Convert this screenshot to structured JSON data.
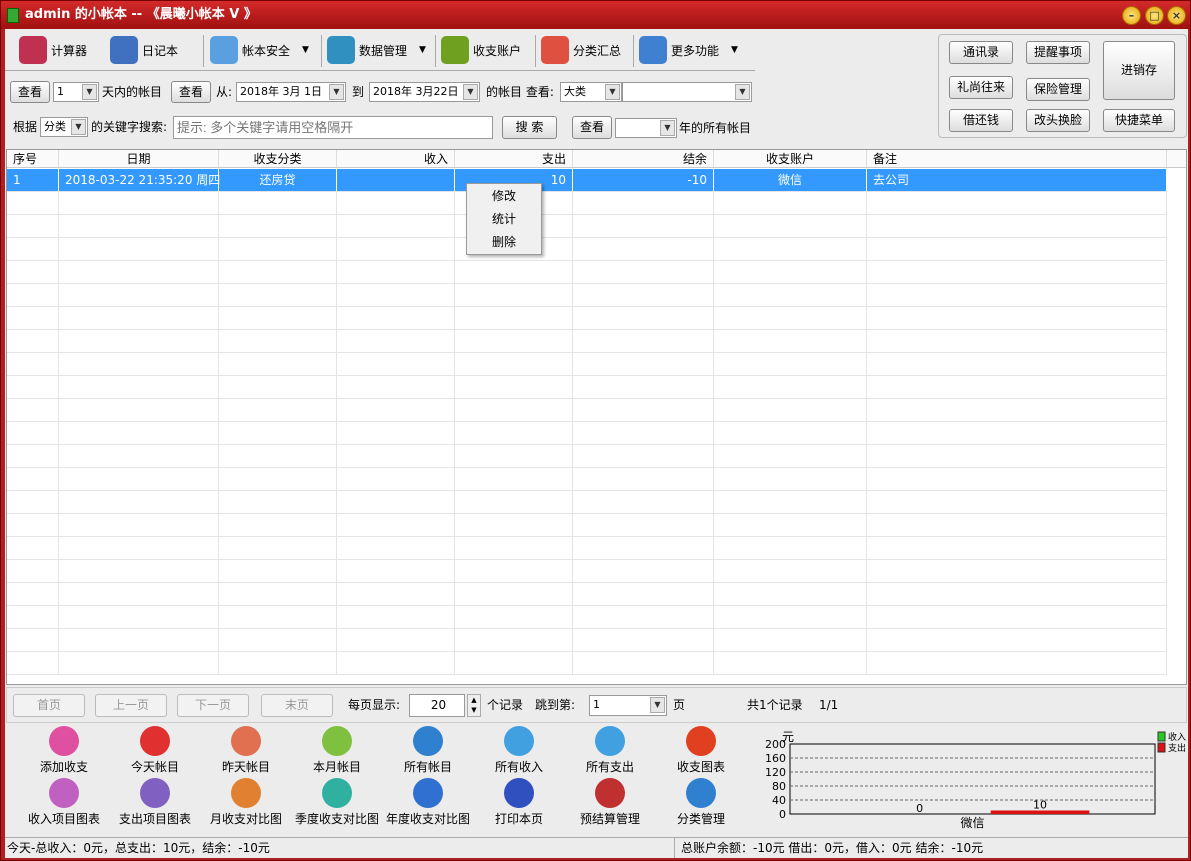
{
  "window": {
    "title": "admin 的小帐本 -- 《晨曦小帐本 V  》",
    "minimize": "–",
    "maximize": "□",
    "close": "×"
  },
  "toolbar": [
    {
      "label": "计算器",
      "icon": "calculator-icon",
      "color": "#c03050"
    },
    {
      "label": "日记本",
      "icon": "notebook-icon",
      "color": "#4070c0"
    },
    {
      "label": "帐本安全",
      "icon": "calendar-icon",
      "color": "#5aa0e0",
      "dropdown": true
    },
    {
      "label": "数据管理",
      "icon": "database-icon",
      "color": "#3090c0",
      "dropdown": true
    },
    {
      "label": "收支账户",
      "icon": "chart-icon",
      "color": "#70a020"
    },
    {
      "label": "分类汇总",
      "icon": "arrow-icon",
      "color": "#e05040"
    },
    {
      "label": "更多功能",
      "icon": "printer-icon",
      "color": "#4080d0",
      "dropdown": true
    }
  ],
  "quick": {
    "contacts": "通讯录",
    "reminders": "提醒事项",
    "inventory": "进销存",
    "gifts": "礼尚往来",
    "insurance": "保险管理",
    "loans": "借还钱",
    "skin": "改头换脸",
    "shortcut": "快捷菜单"
  },
  "filter": {
    "view": "查看",
    "days_value": "1",
    "days_label": "天内的帐目",
    "view2": "查看",
    "from_label": "从:",
    "from_date": "2018年 3月 1日",
    "to_label": "到",
    "to_date": "2018年 3月22日",
    "accounts_label": "的帐目 查看:",
    "category_level": "大类",
    "category_value": "",
    "by_label": "根据",
    "by_value": "分类",
    "keyword_label": "的关键字搜索:",
    "keyword_placeholder": "提示: 多个关键字请用空格隔开",
    "search": "搜 索",
    "view3": "查看",
    "year_value": "",
    "year_label": "年的所有帐目"
  },
  "table": {
    "columns": [
      "序号",
      "日期",
      "收支分类",
      "收入",
      "支出",
      "结余",
      "收支账户",
      "备注"
    ],
    "rows": [
      [
        "1",
        "2018-03-22 21:35:20 周四",
        "还房贷",
        "",
        "10",
        "-10",
        "微信",
        "去公司"
      ]
    ]
  },
  "context_menu": [
    "修改",
    "统计",
    "删除"
  ],
  "pagination": {
    "first": "首页",
    "prev": "上一页",
    "next": "下一页",
    "last": "末页",
    "per_page_label": "每页显示:",
    "per_page": "20",
    "records_label": "个记录",
    "jump_label": "跳到第:",
    "page": "1",
    "page_label": "页",
    "total": "共1个记录",
    "page_of": "1/1"
  },
  "shortcuts": [
    {
      "label": "添加收支",
      "color": "#e050a0"
    },
    {
      "label": "今天帐目",
      "color": "#e03030"
    },
    {
      "label": "昨天帐目",
      "color": "#e07050"
    },
    {
      "label": "本月帐目",
      "color": "#80c040"
    },
    {
      "label": "所有帐目",
      "color": "#3080d0"
    },
    {
      "label": "所有收入",
      "color": "#40a0e0"
    },
    {
      "label": "所有支出",
      "color": "#40a0e0"
    },
    {
      "label": "收支图表",
      "color": "#e04020"
    },
    {
      "label": "收入项目图表",
      "color": "#c060c0"
    },
    {
      "label": "支出项目图表",
      "color": "#8060c0"
    },
    {
      "label": "月收支对比图",
      "color": "#e08030"
    },
    {
      "label": "季度收支对比图",
      "color": "#30b0a0"
    },
    {
      "label": "年度收支对比图",
      "color": "#3070d0"
    },
    {
      "label": "打印本页",
      "color": "#3050c0"
    },
    {
      "label": "预结算管理",
      "color": "#c03030"
    },
    {
      "label": "分类管理",
      "color": "#3080d0"
    }
  ],
  "chart_data": {
    "type": "bar",
    "ylabel": "元",
    "ylim": [
      0,
      200
    ],
    "yticks": [
      0,
      40,
      80,
      120,
      160,
      200
    ],
    "categories": [
      "微信"
    ],
    "series": [
      {
        "name": "收入",
        "values": [
          0
        ],
        "color": "#22cc22"
      },
      {
        "name": "支出",
        "values": [
          10
        ],
        "color": "#dd1111"
      }
    ],
    "data_labels": [
      "0",
      "10"
    ],
    "grid": true,
    "legend": "top-right"
  },
  "status": {
    "left": "今天-总收入：0元，总支出：10元，结余：-10元",
    "right": "总账户余额：-10元 借出：0元，借入：0元 结余：-10元"
  }
}
